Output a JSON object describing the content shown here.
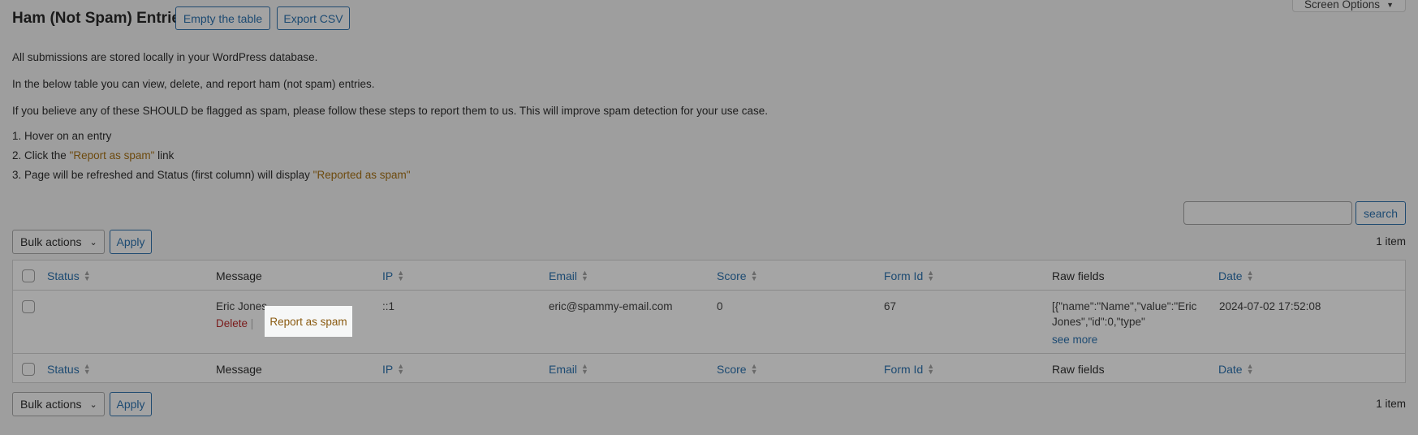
{
  "header": {
    "title": "Ham (Not Spam) Entries",
    "empty_button": "Empty the table",
    "export_button": "Export CSV",
    "screen_options": "Screen Options"
  },
  "intro": {
    "line1": "All submissions are stored locally in your WordPress database.",
    "line2": "In the below table you can view, delete, and report ham (not spam) entries.",
    "line3": "If you believe any of these SHOULD be flagged as spam, please follow these steps to report them to us. This will improve spam detection for your use case.",
    "step1": "1. Hover on an entry",
    "step2_pre": "2. Click the ",
    "step2_hl": "\"Report as spam\"",
    "step2_post": " link",
    "step3_pre": "3. Page will be refreshed and Status (first column) will display ",
    "step3_hl": "\"Reported as spam\""
  },
  "search": {
    "value": "",
    "button": "search"
  },
  "bulk": {
    "label": "Bulk actions",
    "apply": "Apply",
    "count": "1 item"
  },
  "columns": [
    "Status",
    "Message",
    "IP",
    "Email",
    "Score",
    "Form Id",
    "Raw fields",
    "Date"
  ],
  "rows": [
    {
      "status": "",
      "message": "Eric Jones",
      "delete": "Delete",
      "sep": "|",
      "report": "Report as spam",
      "ip": "::1",
      "email": "eric@spammy-email.com",
      "score": "0",
      "form_id": "67",
      "raw_line1": "[{\"name\":\"Name\",\"value\":\"Eric",
      "raw_line2": "Jones\",\"id\":0,\"type\"",
      "see_more": "see more",
      "date": "2024-07-02 17:52:08"
    }
  ],
  "colors": {
    "link": "#1c4a72",
    "highlight": "#6d4a0e",
    "delete": "#7a1a1a",
    "overlay": "#9e9e9e"
  }
}
